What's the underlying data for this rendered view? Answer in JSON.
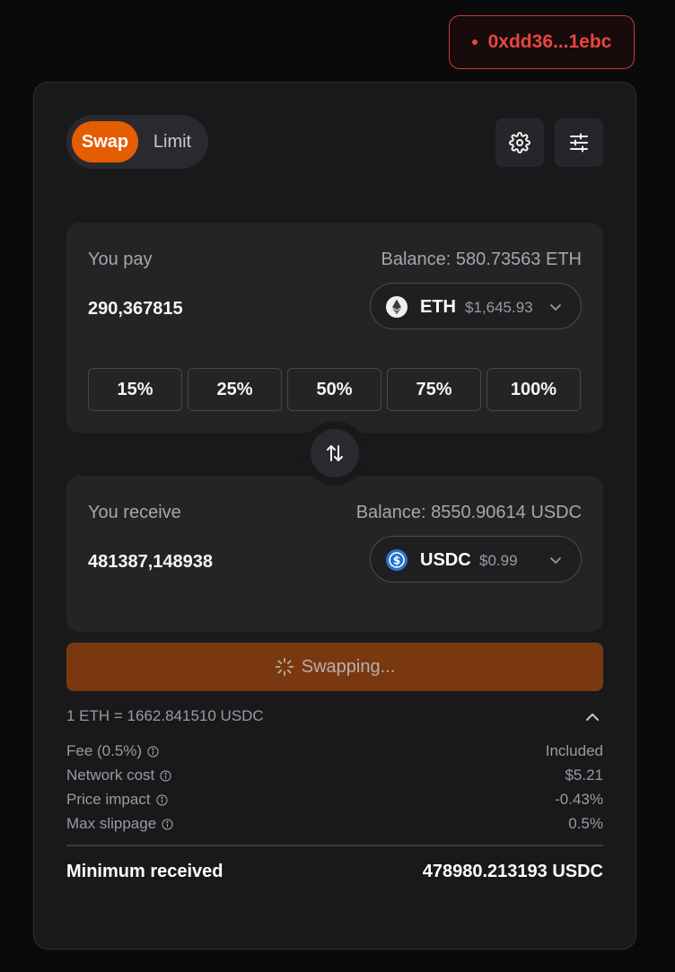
{
  "wallet": {
    "address": "0xdd36...1ebc",
    "status_color": "#e8463e"
  },
  "tabs": {
    "swap": "Swap",
    "limit": "Limit",
    "active": "Swap"
  },
  "icons": {
    "settings": "gear-icon",
    "filters": "sliders-icon",
    "flip": "swap-arrows-icon",
    "spinner": "spinner-icon"
  },
  "pay": {
    "label": "You pay",
    "balance": "Balance: 580.73563 ETH",
    "amount": "290,367815",
    "token": {
      "symbol": "ETH",
      "price": "$1,645.93",
      "icon": "ethereum-icon"
    },
    "percents": [
      "15%",
      "25%",
      "50%",
      "75%",
      "100%"
    ]
  },
  "receive": {
    "label": "You receive",
    "balance": "Balance: 8550.90614 USDC",
    "amount": "481387,148938",
    "token": {
      "symbol": "USDC",
      "price": "$0.99",
      "icon": "usdc-icon"
    }
  },
  "action": {
    "label": "Swapping..."
  },
  "details": {
    "rate": "1 ETH = 1662.841510 USDC",
    "rows": [
      {
        "key": "Fee (0.5%)",
        "value": "Included"
      },
      {
        "key": "Network cost",
        "value": "$5.21"
      },
      {
        "key": "Price impact",
        "value": "-0.43%"
      },
      {
        "key": "Max slippage",
        "value": "0.5%"
      }
    ],
    "minimum_label": "Minimum received",
    "minimum_value": "478980.213193 USDC"
  },
  "colors": {
    "accent": "#e65c00",
    "button_disabled": "#7a3810",
    "background": "#0a0a0b",
    "card": "#19191c"
  }
}
